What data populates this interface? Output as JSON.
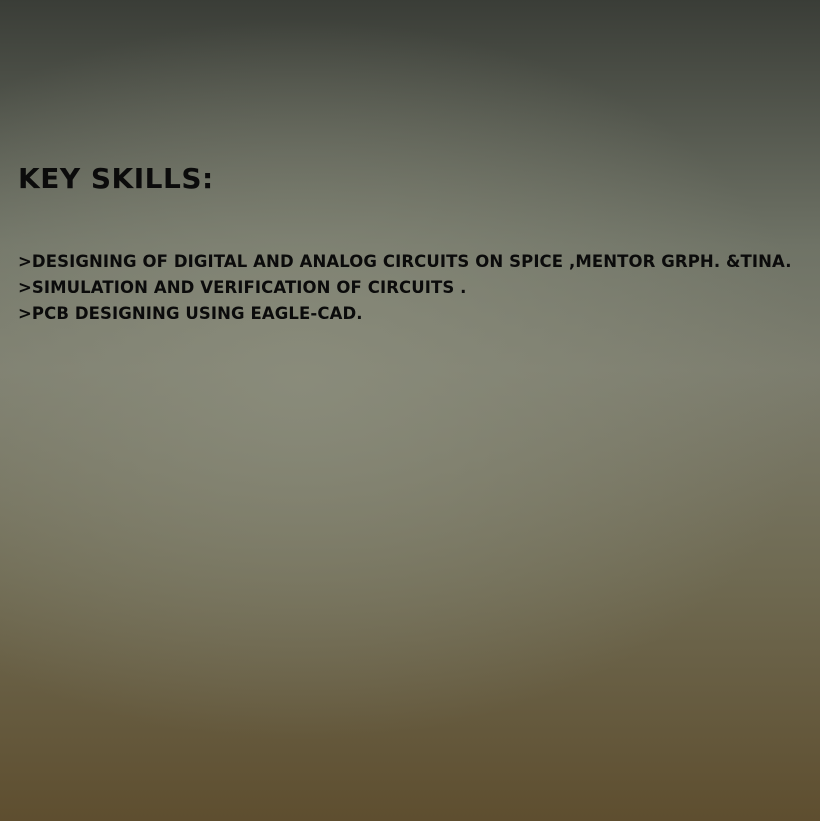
{
  "slide": {
    "heading": "KEY SKILLS:",
    "skills": [
      ">DESIGNING OF DIGITAL AND ANALOG CIRCUITS ON SPICE ,MENTOR GRPH. &TINA.",
      ">SIMULATION AND VERIFICATION OF CIRCUITS .",
      ">PCB DESIGNING USING EAGLE-CAD."
    ]
  },
  "colors": {
    "text": "#0b0b0b",
    "background_top": "#3a3d37",
    "background_mid": "#7c7d6e",
    "background_bottom": "#5e4e2f"
  }
}
